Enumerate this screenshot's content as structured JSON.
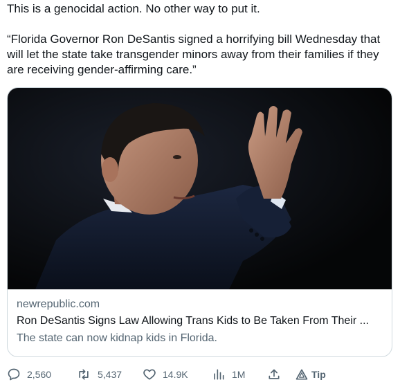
{
  "tweet": {
    "line1": "This is a genocidal action. No other way to put it.",
    "quote": "“Florida Governor Ron DeSantis signed a horrifying bill Wednesday that will let the state take transgender minors away from their families if they are receiving gender-affirming care.”"
  },
  "card": {
    "image_icon": "photo-man-waving",
    "domain": "newrepublic.com",
    "title": "Ron DeSantis Signs Law Allowing Trans Kids to Be Taken From Their ...",
    "description": "The state can now kidnap kids in Florida."
  },
  "actions": {
    "replies": "2,560",
    "retweets": "5,437",
    "likes": "14.9K",
    "views": "1M",
    "tip_label": "Tip"
  },
  "colors": {
    "text": "#0f1419",
    "secondary": "#536471",
    "border": "#cfd9de"
  }
}
